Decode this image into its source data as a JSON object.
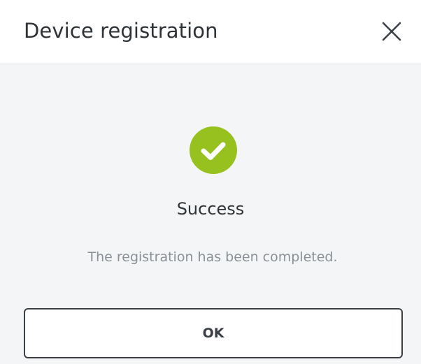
{
  "dialog": {
    "title": "Device registration",
    "close_icon": "close-icon"
  },
  "status": {
    "icon": "checkmark-circle-icon",
    "icon_color": "#96c11f",
    "title": "Success",
    "message": "The registration has been completed."
  },
  "actions": {
    "ok_label": "OK"
  }
}
